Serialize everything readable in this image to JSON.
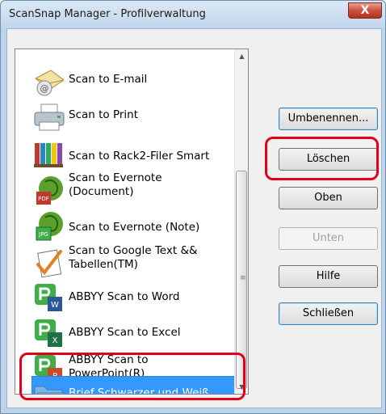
{
  "window": {
    "title": "ScanSnap Manager - Profilverwaltung",
    "close_symbol": "X"
  },
  "profiles": [
    {
      "label": "Scan to E-mail",
      "icon": "envelope-icon"
    },
    {
      "label": "Scan to Print",
      "icon": "printer-icon"
    },
    {
      "label": "Scan to Rack2-Filer Smart",
      "icon": "binders-icon"
    },
    {
      "label": "Scan to Evernote (Document)",
      "icon": "evernote-pdf-icon"
    },
    {
      "label": "Scan to Evernote (Note)",
      "icon": "evernote-jpg-icon"
    },
    {
      "label": "Scan to Google Text && Tabellen(TM)",
      "icon": "google-docs-icon"
    },
    {
      "label": "ABBYY Scan to Word",
      "icon": "abbyy-word-icon"
    },
    {
      "label": "ABBYY Scan to Excel",
      "icon": "abbyy-excel-icon"
    },
    {
      "label": "ABBYY Scan to PowerPoint(R)",
      "icon": "abbyy-powerpoint-icon"
    },
    {
      "label": "Brief Schwarzer und Weiß",
      "icon": "folder-icon",
      "selected": true
    }
  ],
  "list_text": {
    "p0": "Scan to E-mail",
    "p1": "Scan to Print",
    "p2": "Scan to Rack2-Filer Smart",
    "p3a": "Scan to Evernote",
    "p3b": "(Document)",
    "p4": "Scan to Evernote (Note)",
    "p5a": "Scan to Google Text &&",
    "p5b": "Tabellen(TM)",
    "p6": "ABBYY Scan to Word",
    "p7": "ABBYY Scan to Excel",
    "p8a": "ABBYY Scan to",
    "p8b": "PowerPoint(R)",
    "p9": "Brief Schwarzer und Weiß"
  },
  "buttons": {
    "rename": "Umbenennen...",
    "delete": "Löschen",
    "up": "Oben",
    "down": "Unten",
    "help": "Hilfe",
    "close": "Schließen"
  },
  "colors": {
    "selection": "#3399ff",
    "highlight": "#e3001b"
  }
}
